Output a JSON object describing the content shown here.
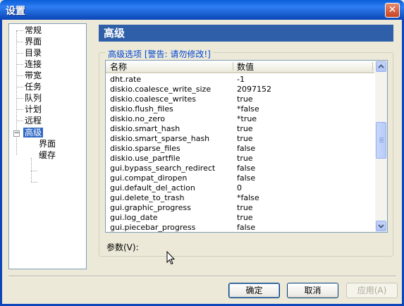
{
  "window": {
    "title": "设置",
    "close_glyph": "✕"
  },
  "tree": {
    "items": [
      {
        "label": "常规"
      },
      {
        "label": "界面"
      },
      {
        "label": "目录"
      },
      {
        "label": "连接"
      },
      {
        "label": "带宽"
      },
      {
        "label": "任务"
      },
      {
        "label": "队列"
      },
      {
        "label": "计划"
      },
      {
        "label": "远程"
      },
      {
        "label": "高级"
      },
      {
        "label": "界面"
      },
      {
        "label": "缓存"
      }
    ],
    "expander_glyph": "−"
  },
  "panel": {
    "header": "高级",
    "group_title": "高级选项 [警告: 请勿修改!]"
  },
  "table": {
    "columns": [
      "名称",
      "数值"
    ],
    "rows": [
      {
        "name": "dht.rate",
        "value": "-1"
      },
      {
        "name": "diskio.coalesce_write_size",
        "value": "2097152"
      },
      {
        "name": "diskio.coalesce_writes",
        "value": "true"
      },
      {
        "name": "diskio.flush_files",
        "value": "*false"
      },
      {
        "name": "diskio.no_zero",
        "value": "*true"
      },
      {
        "name": "diskio.smart_hash",
        "value": "true"
      },
      {
        "name": "diskio.smart_sparse_hash",
        "value": "true"
      },
      {
        "name": "diskio.sparse_files",
        "value": "false"
      },
      {
        "name": "diskio.use_partfile",
        "value": "true"
      },
      {
        "name": "gui.bypass_search_redirect",
        "value": "false"
      },
      {
        "name": "gui.compat_diropen",
        "value": "false"
      },
      {
        "name": "gui.default_del_action",
        "value": "0"
      },
      {
        "name": "gui.delete_to_trash",
        "value": "*false"
      },
      {
        "name": "gui.graphic_progress",
        "value": "true"
      },
      {
        "name": "gui.log_date",
        "value": "true"
      },
      {
        "name": "gui.piecebar_progress",
        "value": "false"
      }
    ]
  },
  "param": {
    "label": "参数(V):"
  },
  "buttons": {
    "ok": "确定",
    "cancel": "取消",
    "apply": "应用(A)"
  },
  "icons": {
    "scroll_up": "scroll-up-arrow-icon",
    "scroll_down": "scroll-down-arrow-icon",
    "close": "close-icon",
    "cursor": "mouse-cursor-icon"
  }
}
